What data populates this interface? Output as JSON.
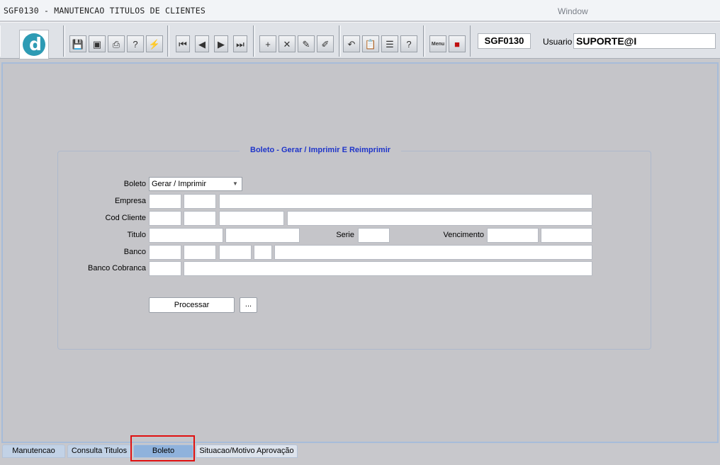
{
  "window": {
    "title": "SGF0130 - MANUTENCAO TITULOS DE CLIENTES",
    "menu": "Window"
  },
  "toolbar": {
    "screen_code": "SGF0130",
    "user_label": "Usuario",
    "user_value": "SUPORTE@I",
    "menu_icon_label": "Menu"
  },
  "form": {
    "section_title": "Boleto - Gerar / Imprimir E Reimprimir",
    "boleto_label": "Boleto",
    "boleto_selected": "Gerar / Imprimir",
    "empresa_label": "Empresa",
    "cod_cliente_label": "Cod Cliente",
    "titulo_label": "Titulo",
    "serie_label": "Serie",
    "vencimento_label": "Vencimento",
    "banco_label": "Banco",
    "banco_cobranca_label": "Banco Cobranca",
    "processar_label": "Processar",
    "ellipsis_label": "..."
  },
  "tabs": [
    {
      "label": "Manutencao"
    },
    {
      "label": "Consulta Titulos"
    },
    {
      "label": "Boleto"
    },
    {
      "label": "Situacao/Motivo Aprovação"
    }
  ],
  "active_tab": "Boleto",
  "colors": {
    "section_title": "#1f35c9",
    "highlight": "#e01010",
    "logo": "#2d9bb4"
  }
}
